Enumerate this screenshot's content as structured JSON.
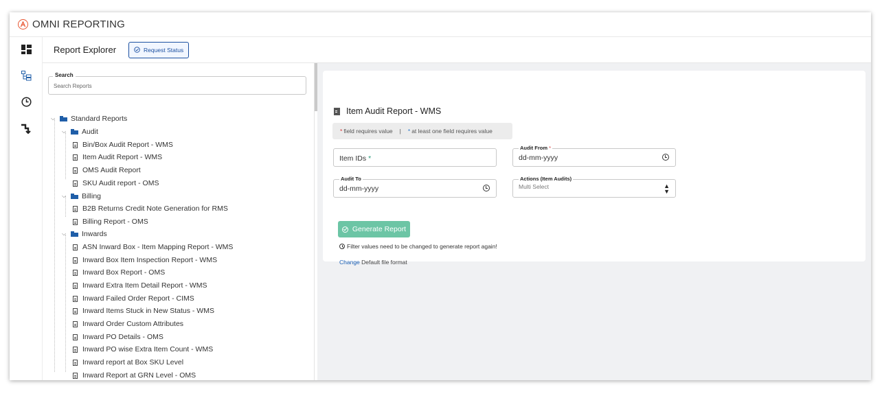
{
  "app": {
    "title": "OMNI REPORTING",
    "accent": "#e8542f"
  },
  "sidebar": {
    "items": [
      {
        "icon": "dashboard-icon"
      },
      {
        "icon": "report-tree-icon"
      },
      {
        "icon": "clock-icon"
      },
      {
        "icon": "workflow-icon"
      }
    ]
  },
  "subheader": {
    "title": "Report Explorer",
    "request_status_label": "Request Status"
  },
  "search": {
    "legend": "Search",
    "placeholder": "Search Reports"
  },
  "tree": {
    "root": "Standard Reports",
    "groups": [
      {
        "label": "Audit",
        "items": [
          "Bin/Box Audit Report - WMS",
          "Item Audit Report - WMS",
          "OMS Audit Report",
          "SKU Audit report - OMS"
        ]
      },
      {
        "label": "Billing",
        "items": [
          "B2B Returns Credit Note Generation for RMS",
          "Billing Report - OMS"
        ]
      },
      {
        "label": "Inwards",
        "items": [
          "ASN Inward Box - Item Mapping Report - WMS",
          "Inward Box Item Inspection Report - WMS",
          "Inward Box Report - OMS",
          "Inward Extra Item Detail Report - WMS",
          "Inward Failed Order Report - CIMS",
          "Inward Items Stuck in New Status - WMS",
          "Inward Order Custom Attributes",
          "Inward PO Details - OMS",
          "Inward PO wise Extra Item Count - WMS",
          "Inward report at Box SKU Level",
          "Inward Report at GRN Level - OMS"
        ]
      }
    ]
  },
  "report": {
    "title": "Item Audit Report - WMS",
    "legend_required": "field requires value",
    "legend_separator": "|",
    "legend_one_of": "at least one field requires value",
    "item_ids": {
      "label": "Item IDs",
      "required_mark": "*"
    },
    "audit_from": {
      "label": "Audit From",
      "required_mark": "*",
      "value": "dd-mm-yyyy"
    },
    "audit_to": {
      "label": "Audit To",
      "value": "dd-mm-yyyy"
    },
    "actions": {
      "label": "Actions (Item Audits)",
      "placeholder": "Multi Select"
    },
    "generate_label": "Generate Report",
    "note": "Filter values need to be changed to generate report again!",
    "change_link": "Change",
    "change_suffix": "Default file format"
  }
}
